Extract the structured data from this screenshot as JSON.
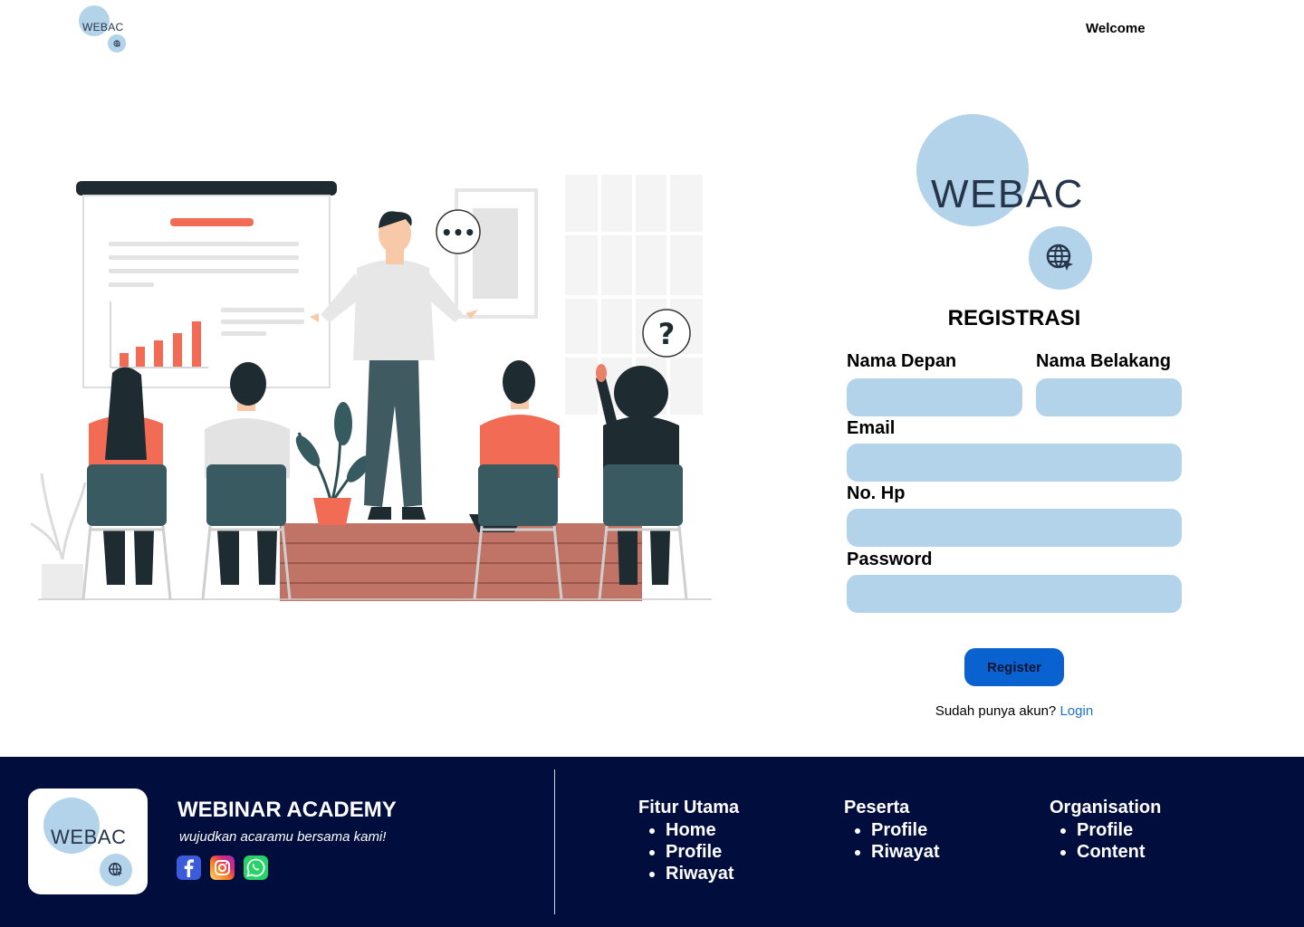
{
  "header": {
    "logo_text": "WEBAC",
    "welcome": "Welcome"
  },
  "form": {
    "logo_text": "WEBAC",
    "title": "REGISTRASI",
    "first_name_label": "Nama Depan",
    "last_name_label": "Nama Belakang",
    "email_label": "Email",
    "phone_label": "No. Hp",
    "password_label": "Password",
    "first_name_value": "",
    "last_name_value": "",
    "email_value": "",
    "phone_value": "",
    "password_value": "",
    "register_button": "Register",
    "have_account_text": "Sudah punya akun?",
    "login_link": "Login"
  },
  "illustration": {
    "speech_dots": "•••",
    "question_mark": "?"
  },
  "footer": {
    "logo_text": "WEBAC",
    "brand": "WEBINAR ACADEMY",
    "tagline": "wujudkan acaramu bersama kami!",
    "social": [
      {
        "icon": "facebook-icon",
        "color": "#3b5bdb"
      },
      {
        "icon": "instagram-icon",
        "color": "#e1306c"
      },
      {
        "icon": "whatsapp-icon",
        "color": "#25d366"
      }
    ],
    "columns": [
      {
        "title": "Fitur Utama",
        "items": [
          "Home",
          "Profile",
          "Riwayat"
        ]
      },
      {
        "title": "Peserta",
        "items": [
          "Profile",
          "Riwayat"
        ]
      },
      {
        "title": "Organisation",
        "items": [
          "Profile",
          "Content"
        ]
      }
    ]
  },
  "colors": {
    "accent_light": "#b3d3ea",
    "primary_button": "#0a62d0",
    "footer_bg": "#000d3d",
    "logo_text": "#26364a"
  }
}
